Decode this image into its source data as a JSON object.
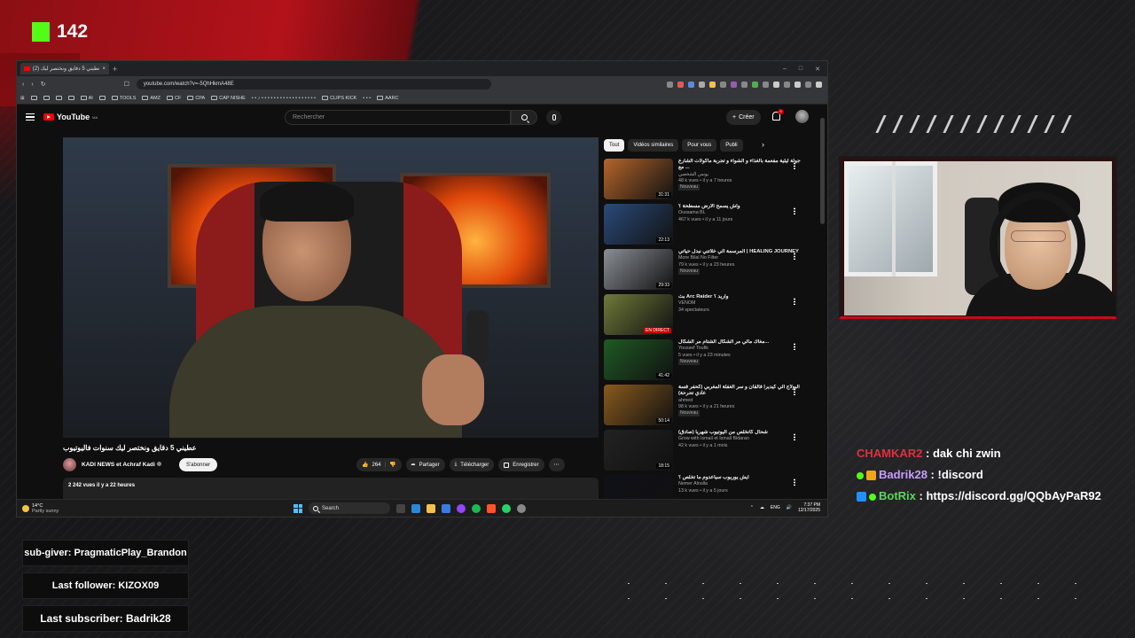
{
  "overlay": {
    "kick_viewers": "142",
    "chat": [
      {
        "user": "CHAMKAR2",
        "message": "dak chi zwin"
      },
      {
        "user": "Badrik28",
        "message": "!discord"
      },
      {
        "user": "BotRix",
        "message": "https://discord.gg/QQbAyPaR92"
      }
    ],
    "sub_giver": "sub-giver: PragmaticPlay_Brandon",
    "last_follower": "Last follower: KIZOX09",
    "last_subscriber": "Last subscriber: Badrik28",
    "accent_red": "#c10e15",
    "kick_green": "#53fc18"
  },
  "browser": {
    "tab_title": "عطيني 5 دقايق ونختصر ليك (2)",
    "url": "youtube.com/watch?v=-5QhHkmA48E",
    "bookmarks": [
      "AI",
      "TOOLS",
      "AMZ",
      "CF",
      "CPA",
      "CAP NISHE",
      "CLIPS KICK",
      "AARC"
    ]
  },
  "youtube": {
    "logo": "YouTube",
    "logo_region": "MA",
    "search_placeholder": "Rechercher",
    "create_label": "Créer",
    "notification_count": "9",
    "video_title": "عطيني 5 دقايق ونختصر ليك سنوات فاليوتيوب",
    "channel_name": "KADI NEWS et Achraf Kadi",
    "subscribe_label": "S'abonner",
    "likes": "264",
    "share_label": "Partager",
    "download_label": "Télécharger",
    "save_label": "Enregistrer",
    "views": "2 242 vues",
    "uploaded": "il y a 22 heures",
    "chips": [
      "Tout",
      "Vidéos similaires",
      "Pour vous",
      "Publi"
    ],
    "recommendations": [
      {
        "title": "جولة ليلية مفعمة بالغذاء و الشواء و تجربة مأكولات الشارع مع ...",
        "channel": "يونس الشخصي",
        "meta": "48 k vues • il y a 7 heures",
        "badge": "Nouveau",
        "duration": "31:31",
        "thumb": "#b5652a"
      },
      {
        "title": "واش يسمح الأرض مسطحة ؟",
        "channel": "Oussama BL",
        "meta": "467 k vues • il y a 11 jours",
        "badge": "",
        "duration": "22:13",
        "thumb": "#2a4b7a"
      },
      {
        "title": "المرسمة الي خلاتني نبدل حياتي | HEALING JOURNEY",
        "channel": "More Bilal No Filter",
        "meta": "79 k vues • il y a 23 heures",
        "badge": "Nouveau",
        "duration": "29:33",
        "thumb": "#8a8f96"
      },
      {
        "title": "بث Arc Raider واريد ؟",
        "channel": "VENOM",
        "meta": "34 spectateurs",
        "badge": "",
        "duration": "EN DIRECT",
        "thumb": "#6f7a3a"
      },
      {
        "title": "مغاك مالي مر الشكال الشتام مر الشكال...",
        "channel": "Youssef Toufik",
        "meta": "5 vues • il y a 23 minutes",
        "badge": "Nouveau",
        "duration": "41:42",
        "thumb": "#1f5a24"
      },
      {
        "title": "البولاج الي كيديرا فالقان و سر الغفلة المغربي (كحفر فسة عادي تحرحة)",
        "channel": "ahmed",
        "meta": "98 k vues • il y a 21 heures",
        "badge": "Nouveau",
        "duration": "50:14",
        "thumb": "#8a5a1e"
      },
      {
        "title": "شحال كانخلص من اليوتيوب شهريا (صادق)",
        "channel": "Grow with Ismail et Ismail Bidaran",
        "meta": "42 k vues • il y a 1 mois",
        "badge": "",
        "duration": "18:15",
        "thumb": "#222222"
      },
      {
        "title": "ايش يوريوب سياعدوم ما تخلص ؟",
        "channel": "Nemer Alnulla",
        "meta": "13 k vues • il y a 5 jours",
        "badge": "",
        "duration": "",
        "thumb": "#101018"
      }
    ]
  },
  "taskbar": {
    "temp": "14°C",
    "weather": "Partly sunny",
    "search_label": "Search",
    "lang": "ENG",
    "time": "7:37 PM",
    "date": "12/17/2025"
  }
}
